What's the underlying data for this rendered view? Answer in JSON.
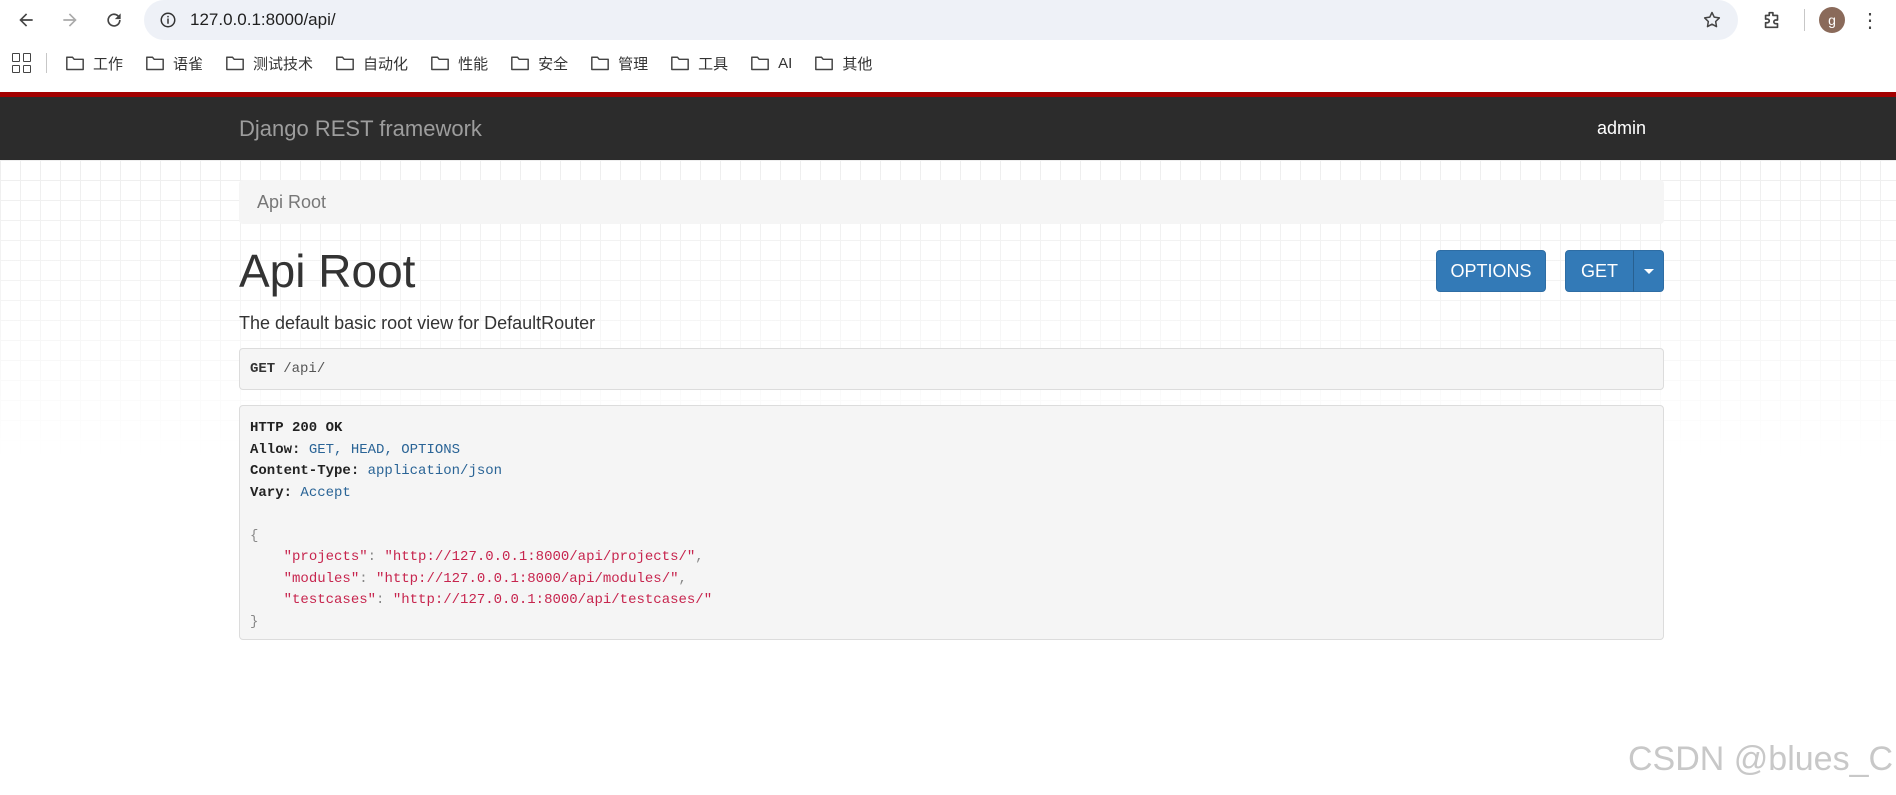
{
  "browser": {
    "url": "127.0.0.1:8000/api/",
    "avatar_letter": "g",
    "bookmarks": [
      "工作",
      "语雀",
      "测试技术",
      "自动化",
      "性能",
      "安全",
      "管理",
      "工具",
      "AI",
      "其他"
    ]
  },
  "navbar": {
    "brand": "Django REST framework",
    "user": "admin"
  },
  "breadcrumb": "Api Root",
  "page": {
    "title": "Api Root",
    "description": "The default basic root view for DefaultRouter",
    "options_label": "OPTIONS",
    "get_label": "GET"
  },
  "request": {
    "method": "GET",
    "path": "/api/"
  },
  "response": {
    "status": "HTTP 200 OK",
    "headers": [
      {
        "name": "Allow:",
        "value": "GET, HEAD, OPTIONS"
      },
      {
        "name": "Content-Type:",
        "value": "application/json"
      },
      {
        "name": "Vary:",
        "value": "Accept"
      }
    ],
    "open_brace": "{",
    "close_brace": "}",
    "json": [
      {
        "key": "\"projects\"",
        "value": "\"http://127.0.0.1:8000/api/projects/\"",
        "comma": ","
      },
      {
        "key": "\"modules\"",
        "value": "\"http://127.0.0.1:8000/api/modules/\"",
        "comma": ","
      },
      {
        "key": "\"testcases\"",
        "value": "\"http://127.0.0.1:8000/api/testcases/\"",
        "comma": ""
      }
    ]
  },
  "watermark": "CSDN @blues_C",
  "colors": {
    "navbar": "#2c2c2c",
    "accent_red": "#a30000",
    "button_blue": "#337ab7",
    "json_string": "#c7254e",
    "header_value": "#2a6496"
  }
}
